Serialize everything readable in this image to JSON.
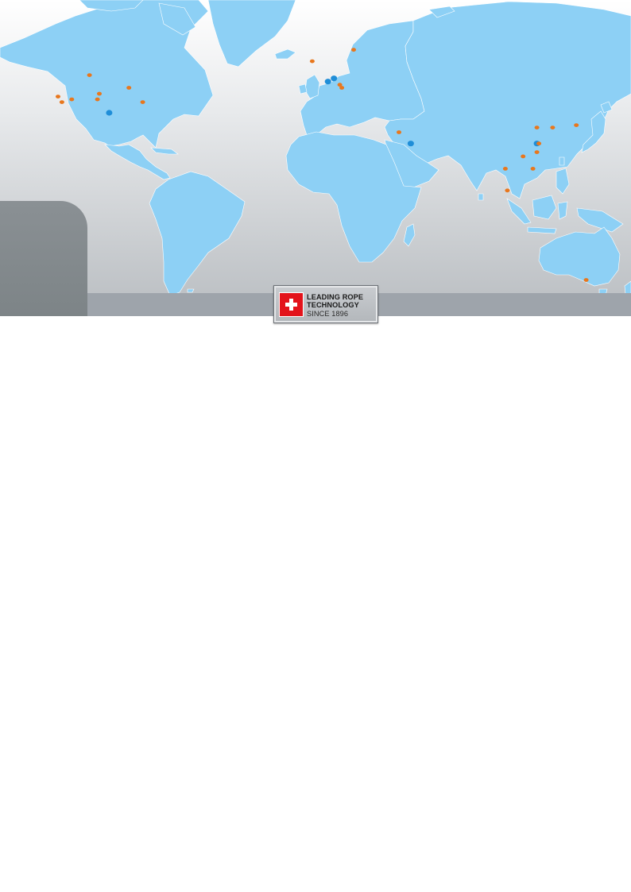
{
  "badge": {
    "line1": "LEADING ROPE",
    "line2": "TECHNOLOGY",
    "line3": "SINCE 1896"
  },
  "colors": {
    "land": "#8dd0f5",
    "sea_top": "#ffffff",
    "sea_bottom": "#b9bdc1",
    "location_marker": "#e8771d",
    "headquarters_marker": "#1f8ed8"
  },
  "markers": [
    {
      "type": "location",
      "lon": -107,
      "lat": 54
    },
    {
      "type": "location",
      "lon": -123,
      "lat": 47
    },
    {
      "type": "location",
      "lon": -121,
      "lat": 45
    },
    {
      "type": "location",
      "lon": -116,
      "lat": 46
    },
    {
      "type": "location",
      "lon": -102,
      "lat": 48
    },
    {
      "type": "location",
      "lon": -103,
      "lat": 46
    },
    {
      "type": "location",
      "lon": -87,
      "lat": 50
    },
    {
      "type": "location",
      "lon": -80,
      "lat": 45
    },
    {
      "type": "headquarters",
      "lon": -97,
      "lat": 41
    },
    {
      "type": "location",
      "lon": 6,
      "lat": 58
    },
    {
      "type": "location",
      "lon": 27,
      "lat": 61
    },
    {
      "type": "headquarters",
      "lon": 14,
      "lat": 52
    },
    {
      "type": "headquarters",
      "lon": 17,
      "lat": 53
    },
    {
      "type": "location",
      "lon": 20,
      "lat": 51
    },
    {
      "type": "location",
      "lon": 21,
      "lat": 50
    },
    {
      "type": "location",
      "lon": 50,
      "lat": 33
    },
    {
      "type": "headquarters",
      "lon": 56,
      "lat": 28
    },
    {
      "type": "location",
      "lon": 120,
      "lat": 35
    },
    {
      "type": "location",
      "lon": 128,
      "lat": 35
    },
    {
      "type": "location",
      "lon": 140,
      "lat": 36
    },
    {
      "type": "headquarters",
      "lon": 120,
      "lat": 28
    },
    {
      "type": "location",
      "lon": 121,
      "lat": 28
    },
    {
      "type": "location",
      "lon": 120,
      "lat": 24
    },
    {
      "type": "location",
      "lon": 113,
      "lat": 22
    },
    {
      "type": "location",
      "lon": 118,
      "lat": 16
    },
    {
      "type": "location",
      "lon": 104,
      "lat": 16
    },
    {
      "type": "location",
      "lon": 105,
      "lat": 5
    },
    {
      "type": "location",
      "lon": 145,
      "lat": -38
    }
  ]
}
